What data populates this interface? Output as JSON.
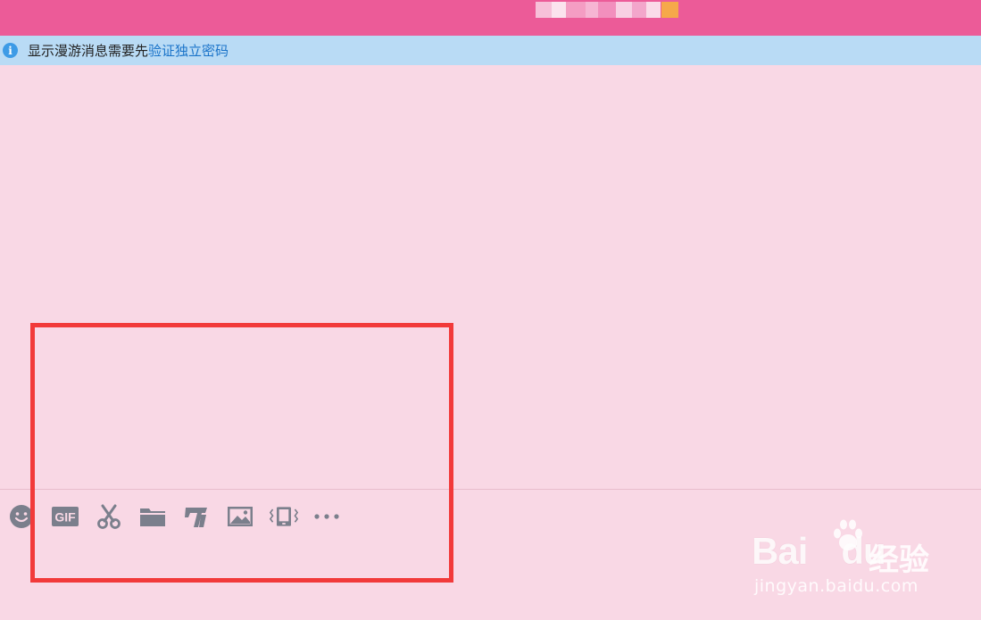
{
  "notice": {
    "text": "显示漫游消息需要先",
    "link": "验证独立密码"
  },
  "toolbar": {
    "items": [
      {
        "name": "emoji",
        "icon": "smiley-icon"
      },
      {
        "name": "gif",
        "icon": "gif-icon",
        "label": "GIF"
      },
      {
        "name": "screenshot",
        "icon": "scissors-icon"
      },
      {
        "name": "file",
        "icon": "folder-icon"
      },
      {
        "name": "font",
        "icon": "font-style-icon"
      },
      {
        "name": "image",
        "icon": "image-icon"
      },
      {
        "name": "shake",
        "icon": "phone-shake-icon"
      },
      {
        "name": "more",
        "icon": "more-dots-icon"
      }
    ]
  },
  "watermark": {
    "logo": "Bai",
    "logo_end": "du",
    "cn": "经验",
    "url": "jingyan.baidu.com"
  },
  "colors": {
    "titlebar": "#ec5b98",
    "background": "#f9d8e5",
    "notice_bg": "#b9dbf5",
    "link": "#1a73c9",
    "icon": "#7b7f8c",
    "highlight": "#f23a3a"
  }
}
